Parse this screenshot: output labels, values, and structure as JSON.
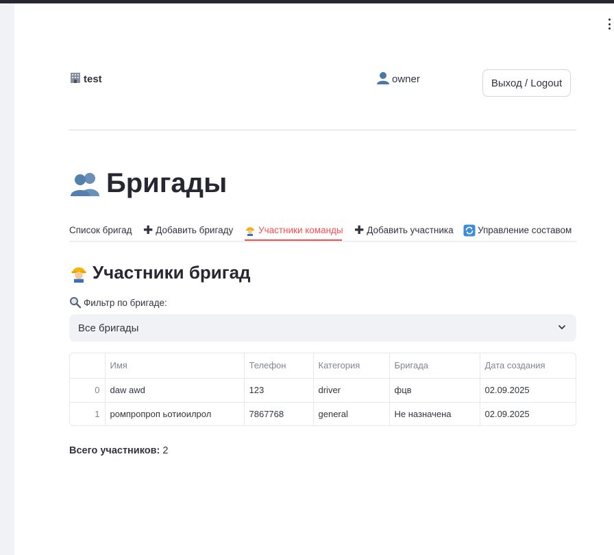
{
  "header": {
    "org_icon": "office-building-icon",
    "org_name": "test",
    "user_icon": "user-silhouette-icon",
    "user_name": "owner",
    "logout_label": "Выход / Logout"
  },
  "page": {
    "title_icon": "two-people-icon",
    "title": "Бригады"
  },
  "tabs": [
    {
      "label": "Список бригад",
      "icon": "",
      "active": false
    },
    {
      "label": "Добавить бригаду",
      "icon": "plus-icon",
      "active": false
    },
    {
      "label": "Участники команды",
      "icon": "construction-worker-icon",
      "active": true
    },
    {
      "label": "Добавить участника",
      "icon": "plus-icon",
      "active": false
    },
    {
      "label": "Управление составом",
      "icon": "refresh-icon",
      "active": false
    }
  ],
  "section": {
    "icon": "construction-worker-icon",
    "title": "Участники бригад"
  },
  "filter": {
    "icon": "magnifier-icon",
    "label": "Фильтр по бригаде:",
    "selected": "Все бригады"
  },
  "table": {
    "columns": [
      "",
      "Имя",
      "Телефон",
      "Категория",
      "Бригада",
      "Дата создания"
    ],
    "rows": [
      {
        "index": "0",
        "name": "daw awd",
        "phone": "123",
        "category": "driver",
        "brigade": "фцв",
        "created": "02.09.2025"
      },
      {
        "index": "1",
        "name": "ромпропроп ьотиоилрол",
        "phone": "7867768",
        "category": "general",
        "brigade": "Не назначена",
        "created": "02.09.2025"
      }
    ]
  },
  "summary": {
    "label": "Всего участников:",
    "value": "2"
  },
  "colors": {
    "accent": "#ff4b4b",
    "text": "#31333f",
    "select_bg": "#f0f2f6"
  }
}
